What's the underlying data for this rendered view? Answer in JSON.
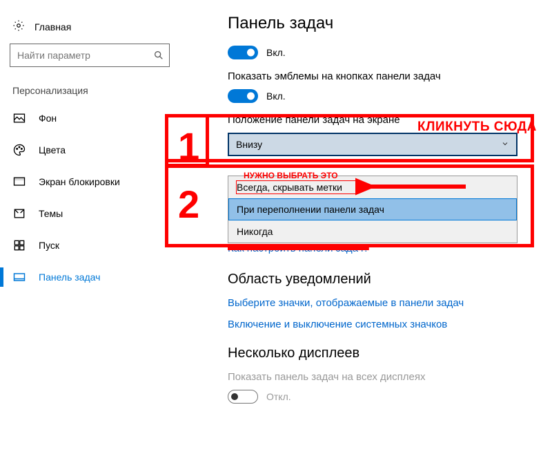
{
  "sidebar": {
    "home": "Главная",
    "search_placeholder": "Найти параметр",
    "section_label": "Персонализация",
    "items": [
      {
        "label": "Фон"
      },
      {
        "label": "Цвета"
      },
      {
        "label": "Экран блокировки"
      },
      {
        "label": "Темы"
      },
      {
        "label": "Пуск"
      },
      {
        "label": "Панель задач"
      }
    ]
  },
  "main": {
    "title": "Панель задач",
    "toggle_on_label": "Вкл.",
    "toggle_off_label": "Откл.",
    "badges_label": "Показать эмблемы на кнопках панели задач",
    "position_label": "Положение панели задач на экране",
    "position_value": "Внизу",
    "combine_options": [
      "Всегда, скрывать метки",
      "При переполнении панели задач",
      "Никогда"
    ],
    "how_link": "Как настроить панели задач?",
    "notification_heading": "Область уведомлений",
    "link_select_icons": "Выберите значки, отображаемые в панели задач",
    "link_system_icons": "Включение и выключение системных значков",
    "multi_display_heading": "Несколько дисплеев",
    "multi_display_label": "Показать панель задач на всех дисплеях"
  },
  "annotations": {
    "step1": "1",
    "step2": "2",
    "click_here": "КЛИКНУТЬ СЮДА",
    "choose_this": "НУЖНО ВЫБРАТЬ ЭТО"
  }
}
